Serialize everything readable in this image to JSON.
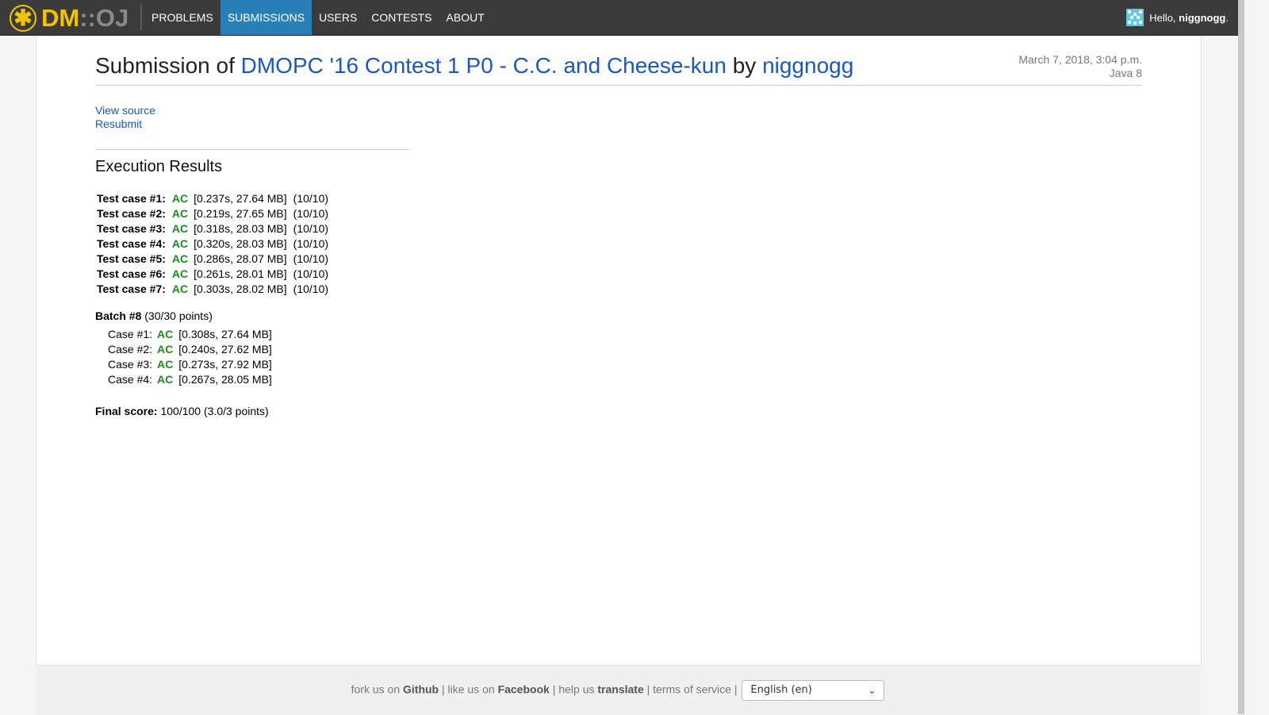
{
  "navbar": {
    "logo_dm": "DM",
    "logo_sep": "::",
    "logo_oj": "OJ",
    "items": [
      {
        "label": "PROBLEMS",
        "active": false
      },
      {
        "label": "SUBMISSIONS",
        "active": true
      },
      {
        "label": "USERS",
        "active": false
      },
      {
        "label": "CONTESTS",
        "active": false
      },
      {
        "label": "ABOUT",
        "active": false
      }
    ],
    "greeting": "Hello, ",
    "username": "niggnogg",
    "greeting_end": "."
  },
  "header": {
    "prefix": "Submission of ",
    "problem": "DMOPC '16 Contest 1 P0 - C.C. and Cheese-kun",
    "by": " by ",
    "user": "niggnogg",
    "date": "March 7, 2018, 3:04 p.m.",
    "language": "Java 8"
  },
  "links": {
    "view_source": "View source",
    "resubmit": "Resubmit"
  },
  "results": {
    "title": "Execution Results",
    "test_cases": [
      {
        "label": "Test case #1:",
        "status": "AC",
        "detail": "[0.237s, 27.64 MB]",
        "points": "(10/10)"
      },
      {
        "label": "Test case #2:",
        "status": "AC",
        "detail": "[0.219s, 27.65 MB]",
        "points": "(10/10)"
      },
      {
        "label": "Test case #3:",
        "status": "AC",
        "detail": "[0.318s, 28.03 MB]",
        "points": "(10/10)"
      },
      {
        "label": "Test case #4:",
        "status": "AC",
        "detail": "[0.320s, 28.03 MB]",
        "points": "(10/10)"
      },
      {
        "label": "Test case #5:",
        "status": "AC",
        "detail": "[0.286s, 28.07 MB]",
        "points": "(10/10)"
      },
      {
        "label": "Test case #6:",
        "status": "AC",
        "detail": "[0.261s, 28.01 MB]",
        "points": "(10/10)"
      },
      {
        "label": "Test case #7:",
        "status": "AC",
        "detail": "[0.303s, 28.02 MB]",
        "points": "(10/10)"
      }
    ],
    "batch": {
      "label": "Batch #8",
      "points": " (30/30 points)",
      "cases": [
        {
          "label": "Case #1:",
          "status": "AC",
          "detail": "[0.308s, 27.64 MB]"
        },
        {
          "label": "Case #2:",
          "status": "AC",
          "detail": "[0.240s, 27.62 MB]"
        },
        {
          "label": "Case #3:",
          "status": "AC",
          "detail": "[0.273s, 27.92 MB]"
        },
        {
          "label": "Case #4:",
          "status": "AC",
          "detail": "[0.267s, 28.05 MB]"
        }
      ]
    },
    "final_label": "Final score:",
    "final_value": " 100/100 (3.0/3 points)"
  },
  "footer": {
    "fork": "fork us on ",
    "github": "Github",
    "like": " | like us on ",
    "facebook": "Facebook",
    "help": " | help us ",
    "translate": "translate",
    "tos": " | terms of service | ",
    "language_selected": "English (en)"
  },
  "colors": {
    "nav_bg": "#3b3b3b",
    "nav_active": "#2980b9",
    "link": "#1958c1",
    "ac": "#1d8e1d",
    "logo_yellow": "#f2c300"
  }
}
